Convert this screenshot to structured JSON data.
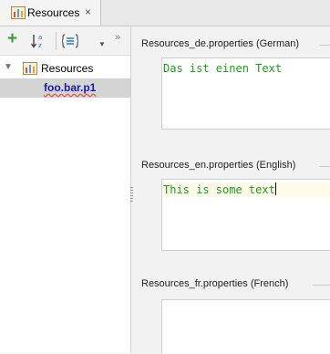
{
  "tab": {
    "title": "Resources",
    "close": "×",
    "icon": "resource-bundle-icon"
  },
  "toolbar": {
    "add_icon": "plus-icon",
    "add_glyph": "+",
    "sort_icon": "sort-alphabetical-icon",
    "group_icon": "group-by-icon",
    "dropdown_glyph": "▼",
    "more_glyph": "»"
  },
  "tree": {
    "root": {
      "label": "Resources",
      "expanded": true,
      "arrow": "▼"
    },
    "children": [
      {
        "label": "foo.bar.p1",
        "selected": true
      }
    ]
  },
  "sections": [
    {
      "title": "Resources_de.properties (German)",
      "text": "Das ist einen Text",
      "focused": false
    },
    {
      "title": "Resources_en.properties (English)",
      "text": "This is some text",
      "focused": true
    },
    {
      "title": "Resources_fr.properties (French)",
      "text": "",
      "focused": false
    }
  ],
  "colors": {
    "value_text": "#1e9c1e",
    "key_text": "#1a1aa6",
    "add_icon": "#3c9a3c"
  }
}
